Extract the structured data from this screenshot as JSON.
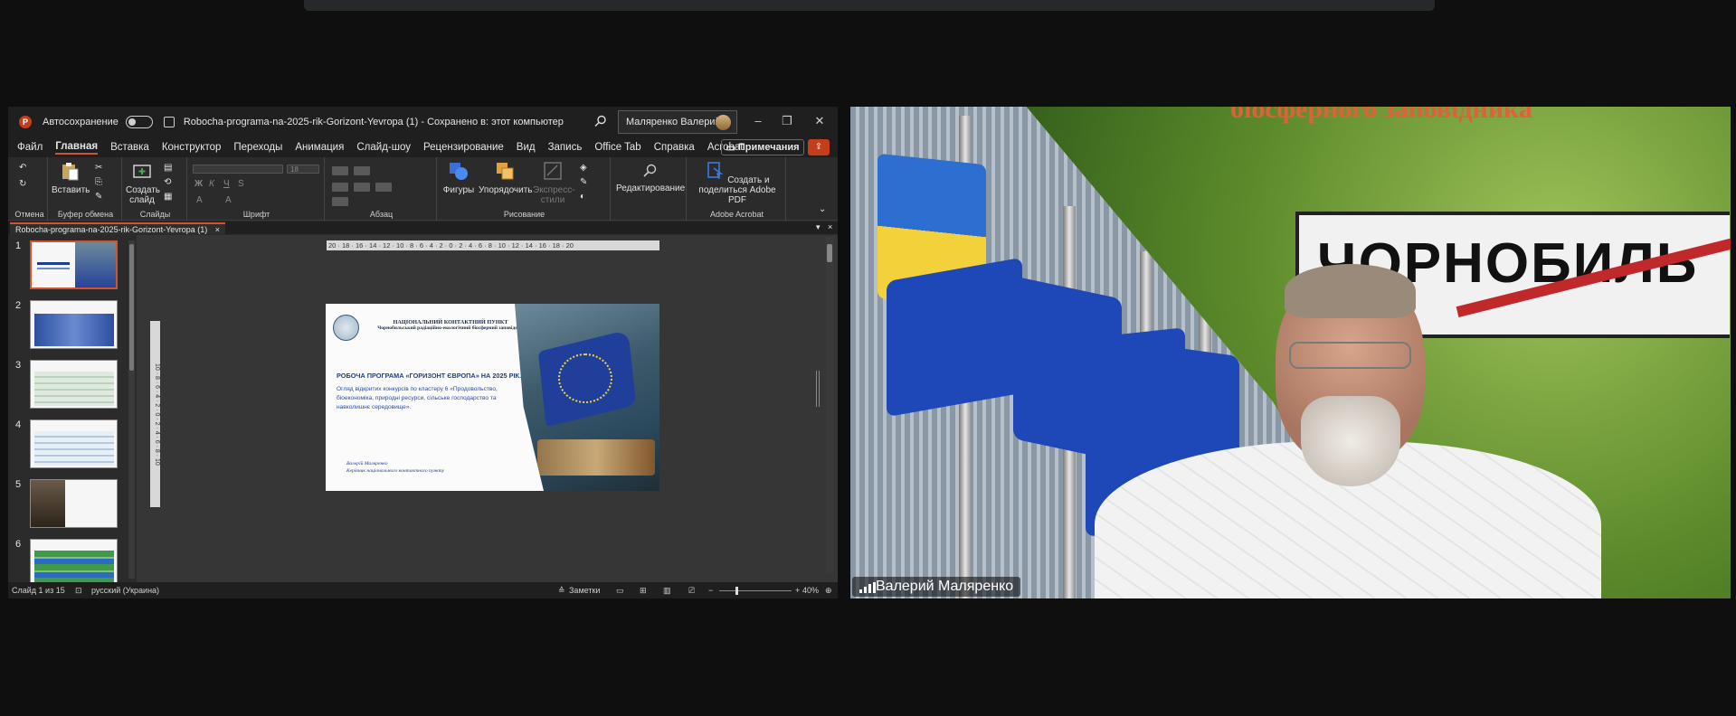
{
  "ppt": {
    "autosave_label": "Автосохранение",
    "doc_title": "Robocha-programa-na-2025-rik-Gorizont-Yevropa (1)  -  Сохранено в: этот компьютер",
    "user_name": "Маляренко Валерий",
    "tabs": [
      "Файл",
      "Главная",
      "Вставка",
      "Конструктор",
      "Переходы",
      "Анимация",
      "Слайд-шоу",
      "Рецензирование",
      "Вид",
      "Запись",
      "Office Tab",
      "Справка",
      "Acrobat"
    ],
    "notes_button": "Примечания",
    "ribbon": {
      "undo_group": "Отмена",
      "paste": "Вставить",
      "clipboard_group": "Буфер обмена",
      "new_slide": "Создать слайд",
      "slides_group": "Слайды",
      "font_size": "18",
      "font_group": "Шрифт",
      "paragraph_group": "Абзац",
      "shapes": "Фигуры",
      "arrange": "Упорядочить",
      "express_styles": "Экспресс-стили",
      "drawing_group": "Рисование",
      "editing": "Редактирование",
      "create_pdf": "Создать и поделиться Adobe PDF",
      "acrobat_group": "Adobe Acrobat"
    },
    "file_tab": "Robocha-programa-na-2025-rik-Gorizont-Yevropa (1)",
    "thumb_numbers": [
      "1",
      "2",
      "3",
      "4",
      "5",
      "6"
    ],
    "ruler_h": "20 · 18 · 16 · 14 · 12 · 10 · 8 · 6 · 4 · 2 · 0 · 2 · 4 · 6 · 8 · 10 · 12 · 14 · 16 · 18 · 20",
    "ruler_v": "10 · 8 · 6 · 4 · 2 · 0 · 2 · 4 · 6 · 8 · 10",
    "slide": {
      "header1": "НАЦІОНАЛЬНИЙ КОНТАКТНИЙ ПУНКТ",
      "header2": "Чорнобильський радіаційно-екологічний біосферний заповідник",
      "title": "РОБОЧА ПРОГРАМА «ГОРИЗОНТ ЄВРОПА» НА 2025 РІК.",
      "subtitle": "Огляд відкритих конкурсів по кластеру 6 «Продовольство, біоекономіка, природні ресурси, сільське господарство та навколишнє середовище».",
      "author1": "Валерій Маляренко",
      "author2": "Керівник національного контактного пункту"
    },
    "status": {
      "slide_counter": "Слайд 1 из 15",
      "language": "русский (Украина)",
      "notes": "Заметки",
      "zoom": "40%"
    }
  },
  "video": {
    "participant_name": "Валерий Маляренко",
    "banner_text": "біосферного заповідника",
    "sign_text": "ЧОРНОБИЛЬ"
  }
}
